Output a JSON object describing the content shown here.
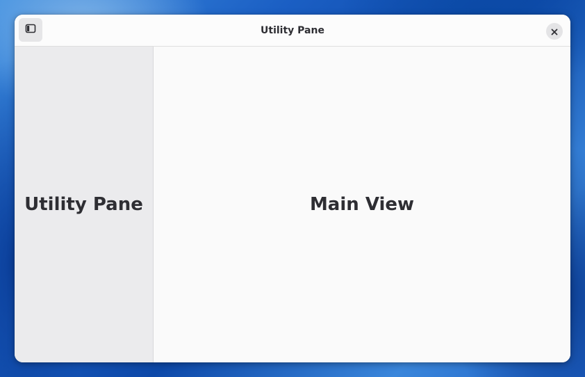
{
  "window": {
    "title": "Utility Pane"
  },
  "header": {
    "sidebar_toggle_icon": "sidebar-show-icon",
    "close_icon": "close-icon"
  },
  "utility_pane": {
    "label": "Utility Pane"
  },
  "main_view": {
    "label": "Main View"
  },
  "colors": {
    "window_bg": "#fafafa",
    "sidebar_bg": "#ebebed",
    "text": "#2e2e33",
    "desktop_accent": "#1b5fc4"
  }
}
